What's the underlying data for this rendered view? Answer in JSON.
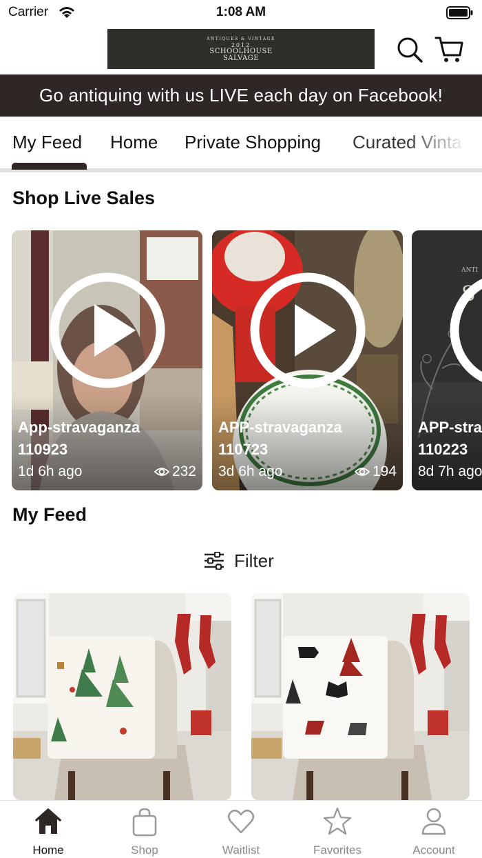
{
  "status_bar": {
    "carrier": "Carrier",
    "time": "1:08 AM"
  },
  "header": {
    "logo": {
      "line1": "ANTIQUES & VINTAGE",
      "line2": "2012",
      "line3": "SCHOOLHOUSE",
      "line4": "SALVAGE"
    },
    "icons": [
      "search-icon",
      "cart-icon"
    ]
  },
  "banner": {
    "text": "Go antiquing with us LIVE each day on Facebook!"
  },
  "tabs": [
    {
      "label": "My Feed",
      "active": true
    },
    {
      "label": "Home"
    },
    {
      "label": "Private Shopping"
    },
    {
      "label": "Curated Vinta"
    }
  ],
  "live_section": {
    "title": "Shop Live Sales",
    "cards": [
      {
        "title_line1": "App-stravaganza",
        "title_line2": "110923",
        "ago": "1d 6h ago",
        "views": "232"
      },
      {
        "title_line1": "APP-stravaganza",
        "title_line2": "110723",
        "ago": "3d 6h ago",
        "views": "194"
      },
      {
        "title_line1": "APP-stravaganza",
        "title_line2": "110223",
        "ago": "8d 7h ago",
        "views": ""
      }
    ]
  },
  "feed_section": {
    "title": "My Feed",
    "filter_label": "Filter"
  },
  "bottom_nav": [
    {
      "label": "Home",
      "icon": "home-icon",
      "active": true
    },
    {
      "label": "Shop",
      "icon": "shopping-bag-icon"
    },
    {
      "label": "Waitlist",
      "icon": "heart-icon"
    },
    {
      "label": "Favorites",
      "icon": "star-icon"
    },
    {
      "label": "Account",
      "icon": "account-icon"
    }
  ],
  "colors": {
    "brand_dark": "#2f2626",
    "logo_bg": "#2e2e2b",
    "inactive_nav": "#888888"
  }
}
